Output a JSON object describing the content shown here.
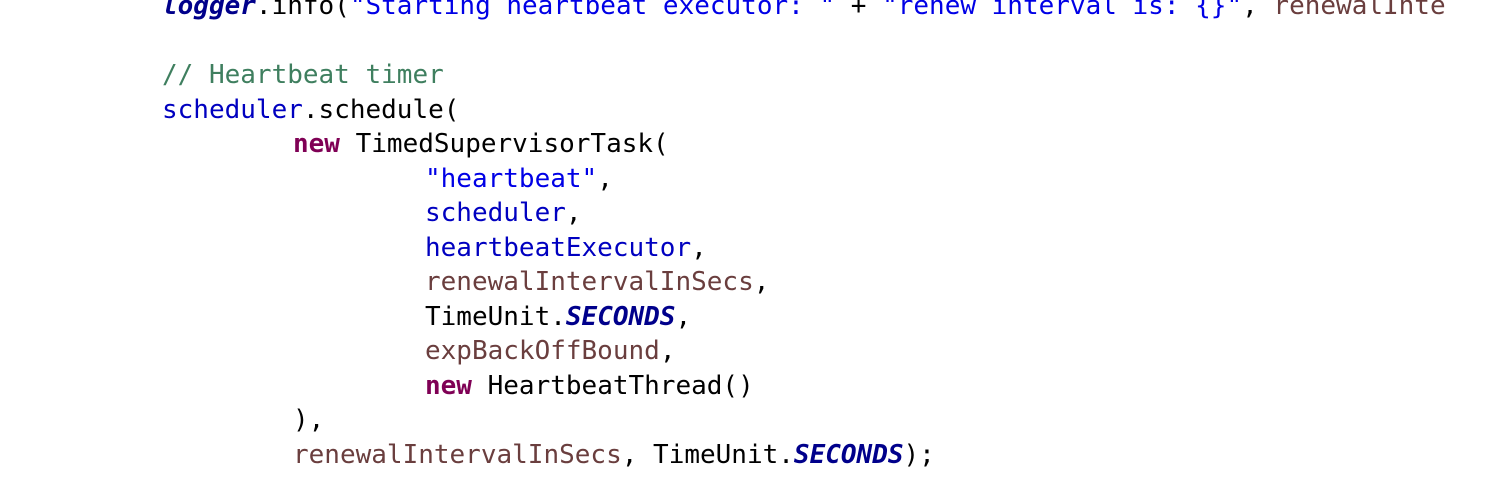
{
  "code": {
    "lines": [
      {
        "tokens": [
          {
            "t": "logger",
            "c": "static"
          },
          {
            "t": ".info(",
            "c": "default"
          },
          {
            "t": "\"Starting heartbeat executor: \"",
            "c": "string"
          },
          {
            "t": " + ",
            "c": "default"
          },
          {
            "t": "\"renew interval is: {}\"",
            "c": "string"
          },
          {
            "t": ", ",
            "c": "default"
          },
          {
            "t": "renewalInte",
            "c": "local"
          }
        ]
      },
      {
        "tokens": []
      },
      {
        "tokens": [
          {
            "t": "// Heartbeat timer",
            "c": "comment"
          }
        ]
      },
      {
        "tokens": [
          {
            "t": "scheduler",
            "c": "field"
          },
          {
            "t": ".schedule(",
            "c": "default"
          }
        ]
      },
      {
        "tokens": [
          {
            "t": "new",
            "c": "keyword"
          },
          {
            "t": " TimedSupervisorTask(",
            "c": "default"
          }
        ]
      },
      {
        "tokens": [
          {
            "t": "\"heartbeat\"",
            "c": "string"
          },
          {
            "t": ",",
            "c": "default"
          }
        ]
      },
      {
        "tokens": [
          {
            "t": "scheduler",
            "c": "field"
          },
          {
            "t": ",",
            "c": "default"
          }
        ]
      },
      {
        "tokens": [
          {
            "t": "heartbeatExecutor",
            "c": "field"
          },
          {
            "t": ",",
            "c": "default"
          }
        ]
      },
      {
        "tokens": [
          {
            "t": "renewalIntervalInSecs",
            "c": "local"
          },
          {
            "t": ",",
            "c": "default"
          }
        ]
      },
      {
        "tokens": [
          {
            "t": "TimeUnit.",
            "c": "default"
          },
          {
            "t": "SECONDS",
            "c": "static"
          },
          {
            "t": ",",
            "c": "default"
          }
        ]
      },
      {
        "tokens": [
          {
            "t": "expBackOffBound",
            "c": "local"
          },
          {
            "t": ",",
            "c": "default"
          }
        ]
      },
      {
        "tokens": [
          {
            "t": "new",
            "c": "keyword"
          },
          {
            "t": " HeartbeatThread()",
            "c": "default"
          }
        ]
      },
      {
        "tokens": [
          {
            "t": "),",
            "c": "default"
          }
        ]
      },
      {
        "tokens": [
          {
            "t": "renewalIntervalInSecs",
            "c": "local"
          },
          {
            "t": ", TimeUnit.",
            "c": "default"
          },
          {
            "t": "SECONDS",
            "c": "static"
          },
          {
            "t": ");",
            "c": "default"
          }
        ]
      }
    ]
  }
}
